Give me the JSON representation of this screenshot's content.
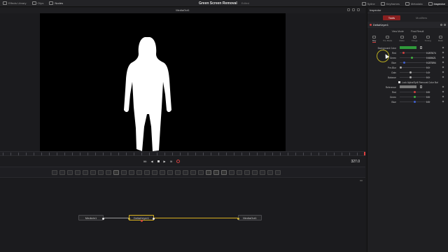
{
  "topbar": {
    "effects_library": "Effects Library",
    "clips": "Clips",
    "nodes": "Nodes",
    "project_title": "Green Screen Removal",
    "edited_status": "Edited",
    "spline": "Spline",
    "keyframes": "Keyframes",
    "metadata": "Metadata",
    "inspector": "Inspector"
  },
  "viewer": {
    "title": "MediaOut1",
    "matte_color": "#ffffff",
    "background_color": "#000000"
  },
  "transport": {
    "timecode": "327.0",
    "frame_left": "ItIt",
    "frame_right": "IIt"
  },
  "nodes": {
    "media_in": "MediaIn1",
    "delta_keyer": "DeltaKeyer1",
    "media_out": "MediaOut1"
  },
  "inspector": {
    "header": "Inspector",
    "tab_tools": "Tools",
    "tab_modifiers": "Modifiers",
    "tool_name": "DeltaKeyer1",
    "view_mode": "View Mode",
    "view_mode_value": "Final Result",
    "subtabs": [
      "Key",
      "Pre Matte",
      "Matte",
      "Fringe",
      "Tuning",
      "Mask"
    ],
    "properties": {
      "background_color_label": "Background Color",
      "background_color": "#2f9a3a",
      "red_label": "Red",
      "red_value": "0.207674",
      "green_label": "Green",
      "green_value": "0.619621",
      "blue_label": "Blue",
      "blue_value": "0.227894",
      "preblur_label": "Pre-Blur",
      "preblur_value": "0.0",
      "gain_label": "Gain",
      "gain_value": "1.0",
      "balance_label": "Balance",
      "balance_value": "0.0",
      "lock_label": "Lock Alpha/Spill Removal Color Bal",
      "reference_label": "Reference",
      "reference_color": "#7a7a7a",
      "ref_red_label": "Red",
      "ref_red_value": "0.5",
      "ref_green_label": "Green",
      "ref_green_value": "0.5",
      "ref_blue_label": "Blue",
      "ref_blue_value": "0.5"
    }
  }
}
